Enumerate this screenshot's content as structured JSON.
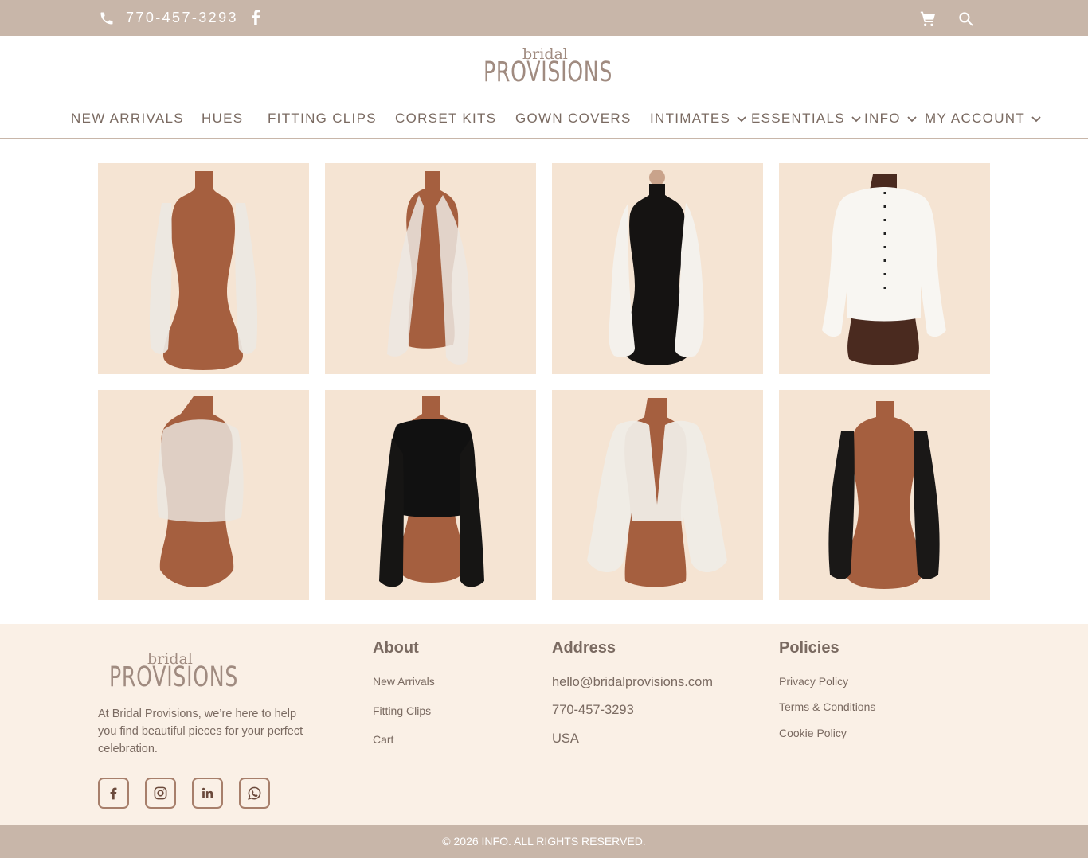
{
  "topbar": {
    "phone": "770-457-3293",
    "icons": [
      "phone-icon",
      "facebook-icon",
      "cart-icon",
      "search-icon"
    ]
  },
  "brand": {
    "line1": "bridal",
    "line2": "PROVISIONS"
  },
  "nav": {
    "items": [
      {
        "label": "NEW ARRIVALS"
      },
      {
        "label": "HUES"
      },
      {
        "label": "FITTING CLIPS"
      },
      {
        "label": "CORSET KITS"
      },
      {
        "label": "GOWN COVERS"
      },
      {
        "label": "INTIMATES"
      },
      {
        "label": "ESSENTIALS"
      },
      {
        "label": "INFO"
      },
      {
        "label": "MY ACCOUNT"
      }
    ]
  },
  "products": [
    {
      "item": "pearl sheer sleeves"
    },
    {
      "item": "tulle bell sleeves"
    },
    {
      "item": "satin balloon sleeves"
    },
    {
      "item": "white cropped jacket"
    },
    {
      "item": "pearl tulle cape top"
    },
    {
      "item": "black lace bell sleeve top"
    },
    {
      "item": "sequin v-back bolero"
    },
    {
      "item": "black beaded sleeves"
    }
  ],
  "footer": {
    "description": "At Bridal Provisions, we’re here to help you find beautiful pieces for your perfect celebration.",
    "social": [
      "facebook-icon",
      "instagram-icon",
      "linkedin-icon",
      "whatsapp-icon"
    ],
    "about": {
      "heading": "About",
      "links": [
        "New Arrivals",
        "Fitting Clips",
        "Cart"
      ]
    },
    "address": {
      "heading": "Address",
      "lines": [
        "hello@bridalprovisions.com",
        "770-457-3293",
        "USA"
      ]
    },
    "policies": {
      "heading": "Policies",
      "links": [
        "Privacy Policy",
        "Terms & Conditions",
        "Cookie Policy"
      ]
    }
  },
  "copyright": "© 2026 INFO. ALL RIGHTS RESERVED.",
  "colors": {
    "bar": "#c8b6a9",
    "card_bg": "#f5e4d3",
    "footer_bg": "#faf0e6",
    "text": "#7a6a61",
    "mannequin": "#a55f3f",
    "social_border": "#a77f6b"
  }
}
